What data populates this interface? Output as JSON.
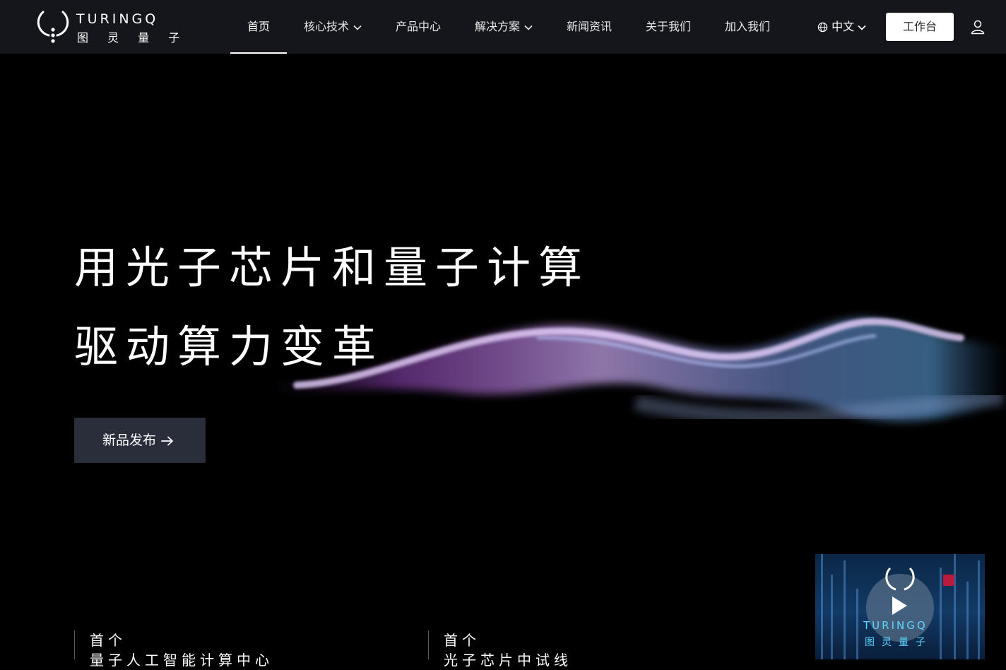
{
  "brand": {
    "name_en": "TURINGQ",
    "name_cn": "图 灵 量 子"
  },
  "nav": {
    "items": [
      {
        "label": "首页",
        "active": true,
        "dropdown": false
      },
      {
        "label": "核心技术",
        "active": false,
        "dropdown": true
      },
      {
        "label": "产品中心",
        "active": false,
        "dropdown": false
      },
      {
        "label": "解决方案",
        "active": false,
        "dropdown": true
      },
      {
        "label": "新闻资讯",
        "active": false,
        "dropdown": false
      },
      {
        "label": "关于我们",
        "active": false,
        "dropdown": false
      },
      {
        "label": "加入我们",
        "active": false,
        "dropdown": false
      }
    ],
    "language": "中文",
    "workbench_label": "工作台"
  },
  "hero": {
    "line1": "用光子芯片和量子计算",
    "line2": "驱动算力变革",
    "cta_label": "新品发布"
  },
  "stats": [
    {
      "label": "首个",
      "value": "量子人工智能计算中心"
    },
    {
      "label": "首个",
      "value": "光子芯片中试线"
    }
  ],
  "video": {
    "title_en": "TURINGQ",
    "title_cn": "图灵量子"
  },
  "colors": {
    "header_bg": "#15161b",
    "brand_accent": "#e0223a",
    "cta_bg": "#2a2e3b"
  }
}
